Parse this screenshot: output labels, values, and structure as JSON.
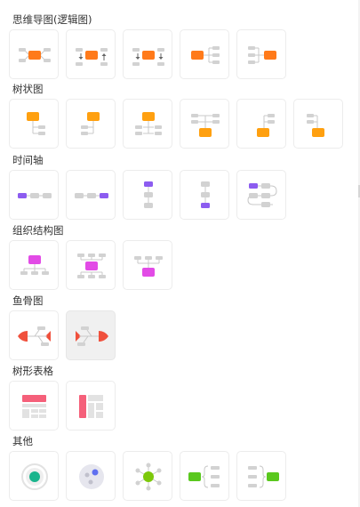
{
  "sections": [
    {
      "title": "思维导图(逻辑图)",
      "items": [
        {
          "name": "mindmap-centered-icon"
        },
        {
          "name": "mindmap-centered-arrows-icon"
        },
        {
          "name": "mindmap-centered-arrows-down-icon"
        },
        {
          "name": "logic-map-left-icon"
        },
        {
          "name": "logic-map-right-icon"
        }
      ]
    },
    {
      "title": "树状图",
      "items": [
        {
          "name": "tree-right-icon"
        },
        {
          "name": "tree-left-icon"
        },
        {
          "name": "tree-both-icon"
        },
        {
          "name": "tree-up-icon"
        },
        {
          "name": "tree-up-left-icon"
        },
        {
          "name": "tree-up-right-icon"
        }
      ]
    },
    {
      "title": "时间轴",
      "items": [
        {
          "name": "timeline-horizontal-left-icon"
        },
        {
          "name": "timeline-horizontal-right-icon"
        },
        {
          "name": "timeline-vertical-top-icon"
        },
        {
          "name": "timeline-vertical-bottom-icon"
        },
        {
          "name": "timeline-serpentine-icon"
        }
      ]
    },
    {
      "title": "组织结构图",
      "items": [
        {
          "name": "org-chart-down-icon"
        },
        {
          "name": "org-chart-middle-icon"
        },
        {
          "name": "org-chart-up-icon"
        }
      ]
    },
    {
      "title": "鱼骨图",
      "items": [
        {
          "name": "fishbone-left-icon"
        },
        {
          "name": "fishbone-right-icon",
          "selected": true
        }
      ]
    },
    {
      "title": "树形表格",
      "items": [
        {
          "name": "tree-table-horizontal-icon"
        },
        {
          "name": "tree-table-vertical-icon"
        }
      ]
    },
    {
      "title": "其他",
      "items": [
        {
          "name": "radial-circle-icon"
        },
        {
          "name": "bubble-map-icon"
        },
        {
          "name": "radial-spokes-icon"
        },
        {
          "name": "brace-right-icon"
        },
        {
          "name": "brace-left-icon"
        }
      ]
    }
  ],
  "colors": {
    "orange": "#ff8a00",
    "orange_light": "#ffb21f",
    "red": "#f0503c",
    "purple": "#8c5cf0",
    "magenta": "#e24be6",
    "pink": "#f5607a",
    "green": "#5ac81e",
    "teal": "#19b48c",
    "gray": "#d2d2d2"
  }
}
